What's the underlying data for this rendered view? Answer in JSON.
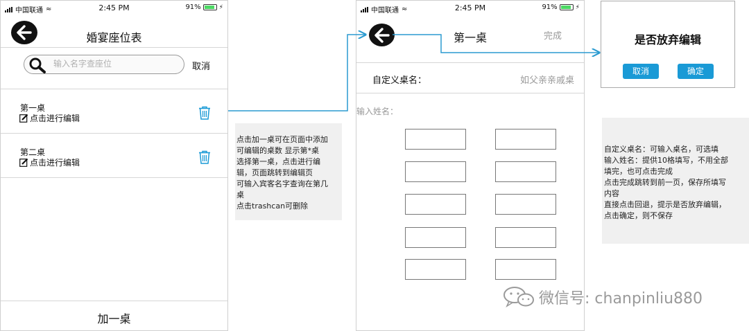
{
  "status_bar": {
    "carrier": "中国联通",
    "time": "2:45 PM",
    "battery_percent": "91%",
    "battery_level": 0.91
  },
  "screen1": {
    "title": "婚宴座位表",
    "search": {
      "placeholder": "输入名字查座位"
    },
    "cancel_label": "取消",
    "tables": [
      {
        "name": "第一桌",
        "edit_label": "点击进行编辑"
      },
      {
        "name": "第二桌",
        "edit_label": "点击进行编辑"
      }
    ],
    "add_label": "加一桌"
  },
  "note1": {
    "lines": [
      "点击加一桌可在页面中添加",
      "可编辑的桌数 显示第*桌",
      "选择第一桌，点击进行编",
      "辑，页面跳转到编辑页",
      "可输入宾客名字查询在第几",
      "桌",
      "点击trashcan可删除"
    ]
  },
  "screen2": {
    "title": "第一桌",
    "done_label": "完成",
    "custom_name_label": "自定义桌名：",
    "custom_name_placeholder": "如父亲亲戚桌",
    "guest_section_label": "输入姓名："
  },
  "dialog": {
    "title": "是否放弃编辑",
    "cancel_label": "取消",
    "confirm_label": "确定"
  },
  "note2": {
    "lines": [
      "自定义桌名：可输入桌名，可选填",
      "输入姓名：提供10格填写，不用全部",
      "填完，也可点击完成",
      "点击完成跳转到前一页，保存所填写",
      "内容",
      "直接点击回退，提示是否放弃编辑，",
      "点击确定，则不保存"
    ]
  },
  "watermark": {
    "text": "微信号: chanpinliu880"
  },
  "colors": {
    "accent": "#1a9ad6",
    "arrow": "#2a9ad0",
    "note_bg": "#f0f0f0"
  }
}
